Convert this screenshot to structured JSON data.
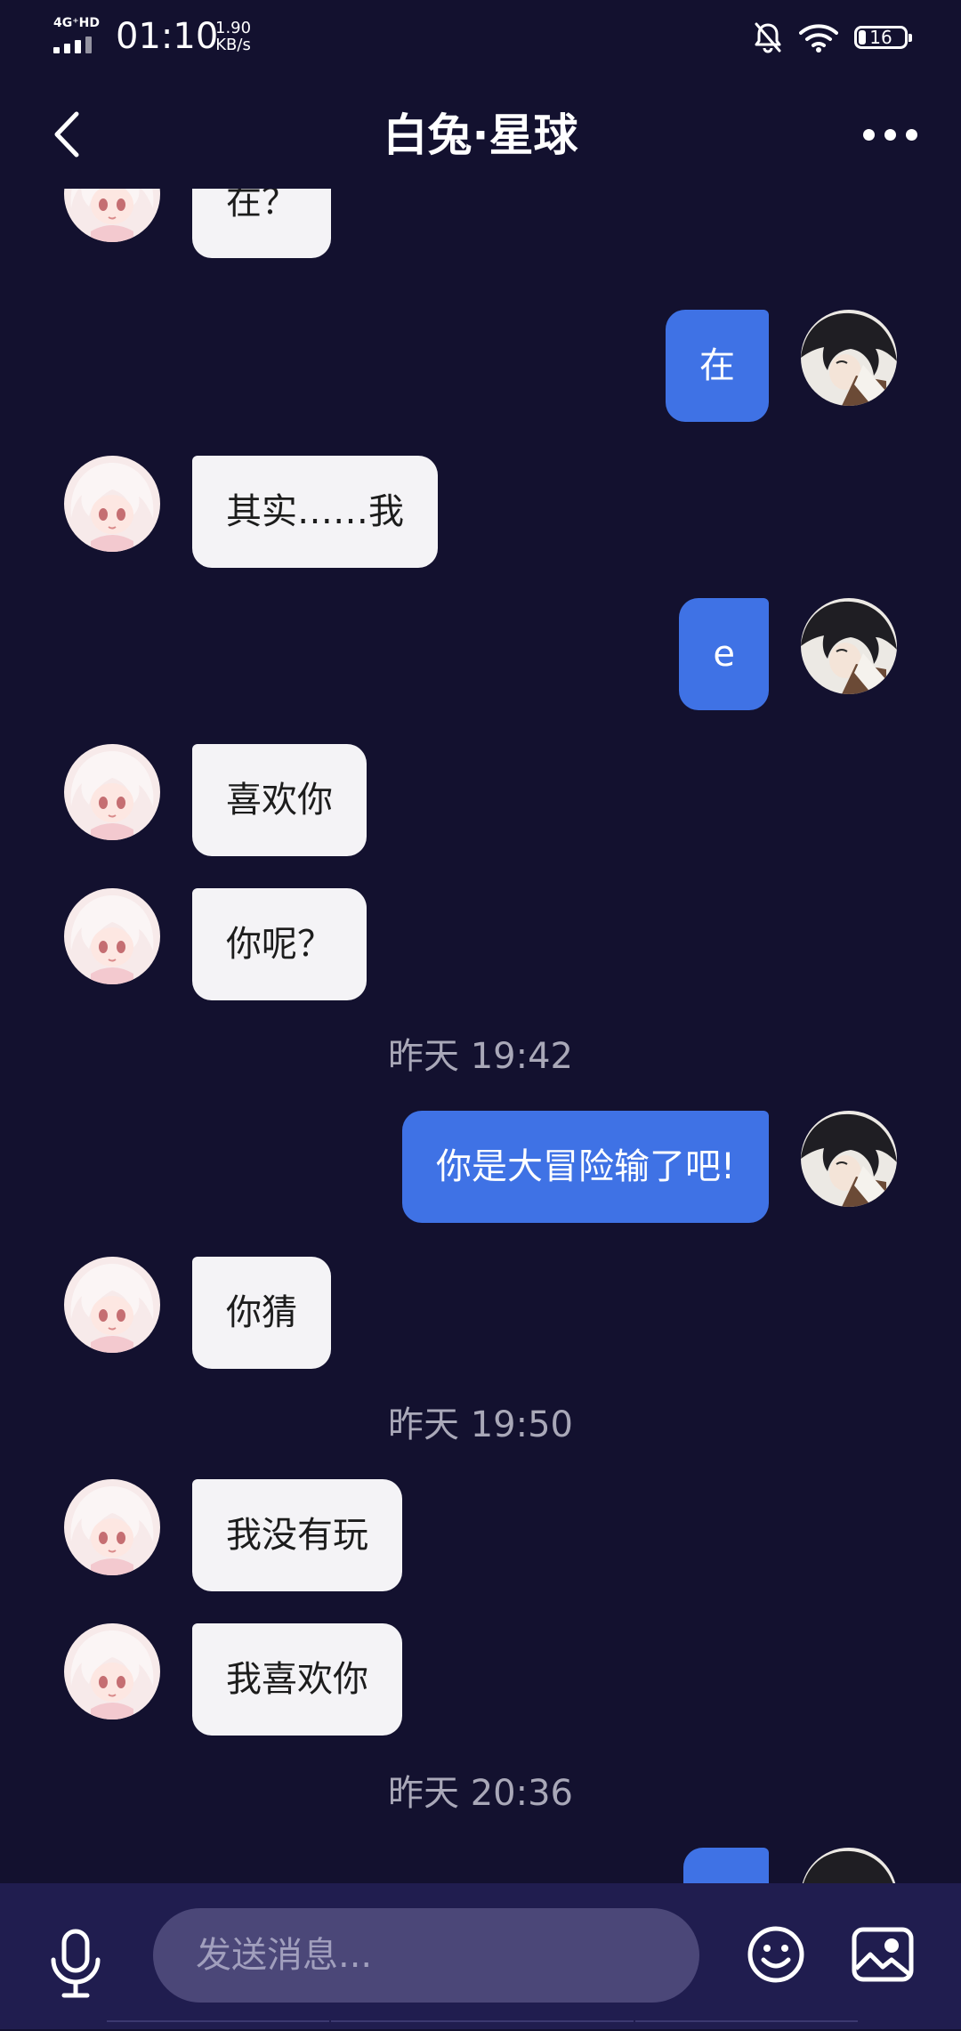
{
  "status_bar": {
    "network": "4G⁺HD",
    "time": "01:10",
    "speed_value": "1.90",
    "speed_unit": "KB/s",
    "battery": "16",
    "icons": [
      "signal-bars-icon",
      "mute-bell-icon",
      "wifi-icon",
      "battery-icon"
    ]
  },
  "header": {
    "title": "白兔·星球",
    "back_icon": "chevron-left-icon",
    "more_icon": "more-dots-icon"
  },
  "messages": [
    {
      "side": "left",
      "text": "在？"
    },
    {
      "side": "right",
      "text": "在"
    },
    {
      "side": "left",
      "text": "其实……我"
    },
    {
      "side": "right",
      "text": "e"
    },
    {
      "side": "left",
      "text": "喜欢你"
    },
    {
      "side": "left",
      "text": "你呢？"
    },
    {
      "time": "昨天 19:42"
    },
    {
      "side": "right",
      "text": "你是大冒险输了吧!"
    },
    {
      "side": "left",
      "text": "你猜"
    },
    {
      "time": "昨天 19:50"
    },
    {
      "side": "left",
      "text": "我没有玩"
    },
    {
      "side": "left",
      "text": "我喜欢你"
    },
    {
      "time": "昨天 20:36"
    },
    {
      "side": "right",
      "text": ""
    }
  ],
  "input_bar": {
    "placeholder": "发送消息...",
    "value": "",
    "icons": [
      "microphone-icon",
      "emoji-icon",
      "image-icon"
    ]
  },
  "colors": {
    "background": "#13112f",
    "incoming_bubble": "#f4f3f6",
    "outgoing_bubble": "#3f72e5",
    "input_bar": "#201d4f",
    "input_field": "#4b4778",
    "timestamp_text": "#a9a8b8"
  }
}
